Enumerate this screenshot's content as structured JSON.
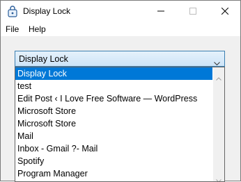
{
  "window": {
    "title": "Display Lock",
    "icon": "lock-app-icon",
    "controls": [
      "minimize-icon",
      "maximize-icon",
      "close-icon"
    ]
  },
  "menu": {
    "file": "File",
    "help": "Help"
  },
  "combo": {
    "selected": "Display Lock"
  },
  "dropdown": {
    "options": [
      "Display Lock",
      "test",
      "Edit Post ‹ I Love Free Software — WordPress",
      "Microsoft Store",
      "Microsoft Store",
      "Mail",
      "Inbox - Gmail ?- Mail",
      "Spotify",
      "Program Manager"
    ],
    "highlighted_index": 0
  },
  "colors": {
    "highlight": "#0078d7",
    "combo_border": "#3c7fb1"
  }
}
